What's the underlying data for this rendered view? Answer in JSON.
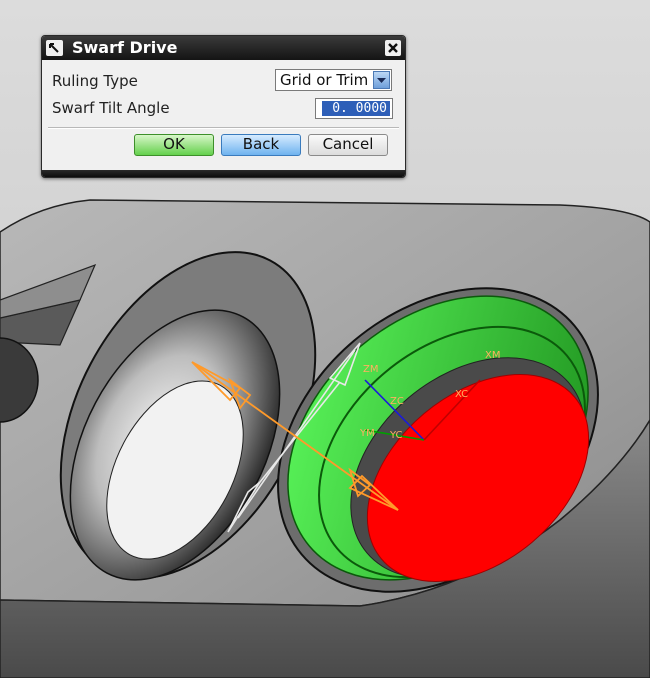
{
  "dialog": {
    "title": "Swarf Drive",
    "ruling_type_label": "Ruling Type",
    "ruling_type_value": "Grid or Trim",
    "tilt_label": "Swarf Tilt Angle",
    "tilt_value": "0. 0000",
    "ok_label": "OK",
    "back_label": "Back",
    "cancel_label": "Cancel"
  },
  "scene": {
    "axis_labels": {
      "xm": "XM",
      "xc": "XC",
      "zm": "ZM",
      "zc": "ZC",
      "ym": "YM",
      "yc": "YC"
    },
    "colors": {
      "part": "#9a9a9a",
      "face_green": "#33dd33",
      "face_red": "#ff0000",
      "vector_orange": "#ff9a2a",
      "tool_outline": "#e8e8e8"
    },
    "icons": {
      "dialog": "pin-icon",
      "close": "close-icon",
      "dropdown": "chevron-down-icon"
    }
  }
}
